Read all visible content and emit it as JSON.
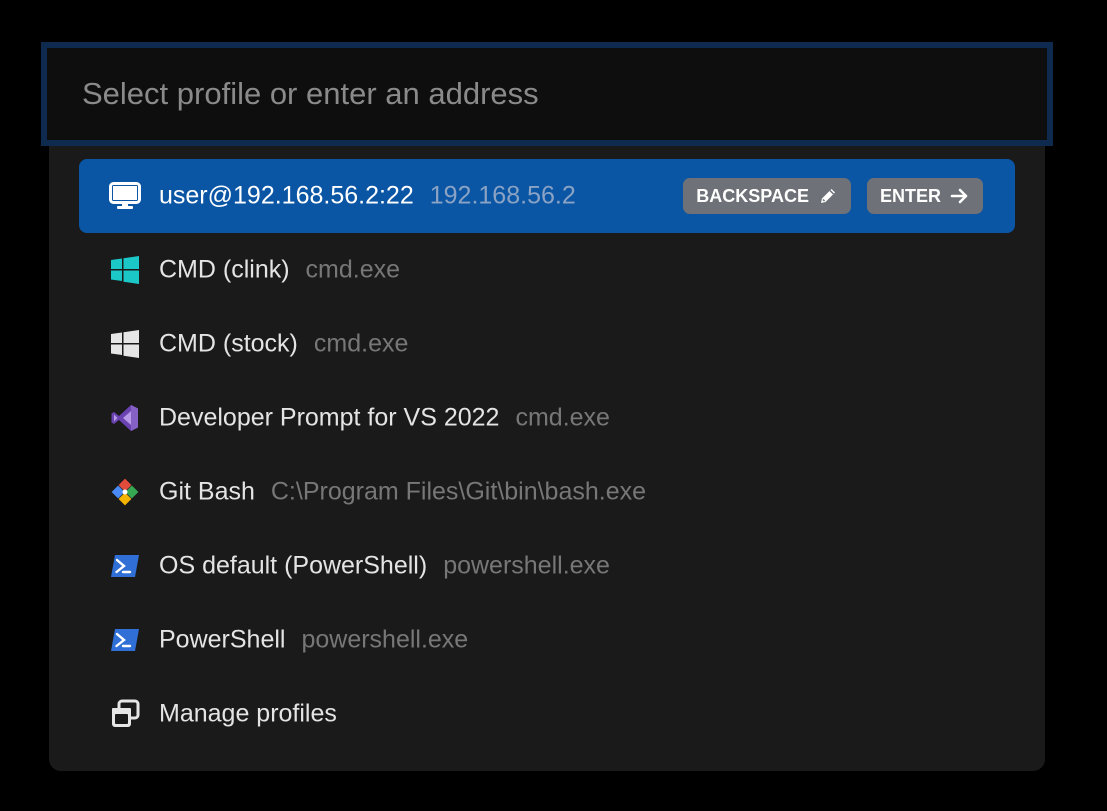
{
  "search": {
    "placeholder": "Select profile or enter an address",
    "value": ""
  },
  "hotkeys": {
    "backspace_label": "BACKSPACE",
    "backspace_icon": "pencil-icon",
    "enter_label": "ENTER",
    "enter_icon": "arrow-right-icon"
  },
  "profiles": [
    {
      "name": "user@192.168.56.2:22",
      "desc": "192.168.56.2",
      "icon": "monitor-icon",
      "selected": true
    },
    {
      "name": "CMD (clink)",
      "desc": "cmd.exe",
      "icon": "windows-icon-teal"
    },
    {
      "name": "CMD (stock)",
      "desc": "cmd.exe",
      "icon": "windows-icon-white"
    },
    {
      "name": "Developer Prompt for VS 2022",
      "desc": "cmd.exe",
      "icon": "visual-studio-icon"
    },
    {
      "name": "Git Bash",
      "desc": "C:\\Program Files\\Git\\bin\\bash.exe",
      "icon": "git-icon"
    },
    {
      "name": "OS default (PowerShell)",
      "desc": "powershell.exe",
      "icon": "powershell-icon"
    },
    {
      "name": "PowerShell",
      "desc": "powershell.exe",
      "icon": "powershell-icon"
    },
    {
      "name": "Manage profiles",
      "desc": "",
      "icon": "window-restore-icon"
    }
  ],
  "colors": {
    "selected_row": "#0a55a4",
    "panel": "#1a1a1a",
    "search_border": "#0e2a4f",
    "hotkey_bg": "#6e7177",
    "windows_teal": "#1cc7c7",
    "vs_purple": "#8661c5",
    "powershell_blue": "#2f6fd6"
  }
}
